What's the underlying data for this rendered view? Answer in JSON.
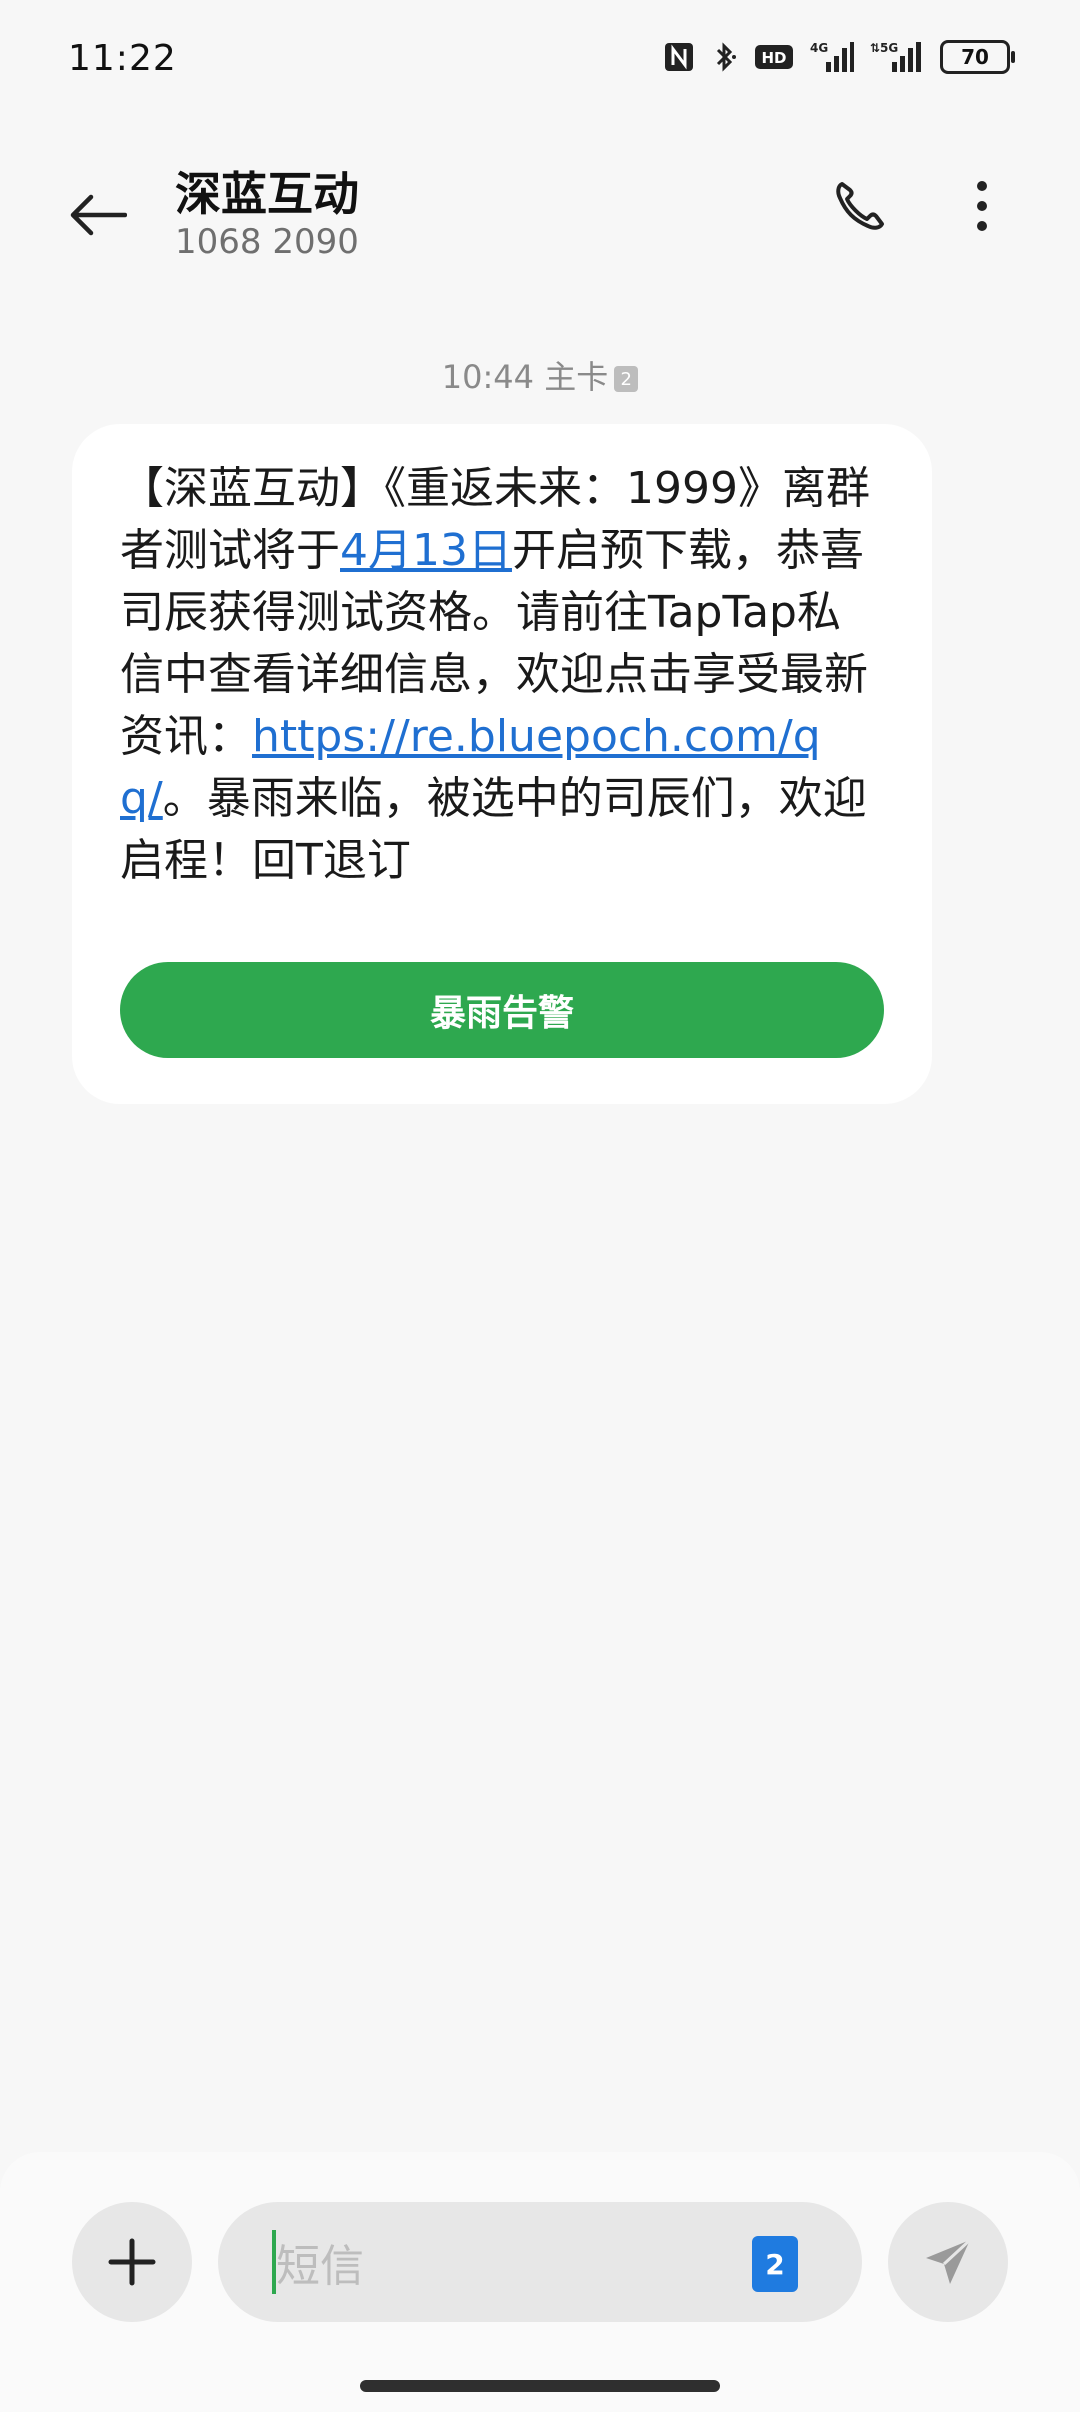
{
  "status_bar": {
    "time": "11:22",
    "battery": "70",
    "icons": [
      "nfc-icon",
      "bluetooth-icon",
      "hd-icon",
      "signal-4g-icon",
      "signal-5g-icon"
    ]
  },
  "header": {
    "contact_name": "深蓝互动",
    "contact_number": "1068 2090"
  },
  "conversation": {
    "timestamp": "10:44 主卡",
    "sim_badge": "2",
    "message": {
      "prefix": "【深蓝互动】《重返未来：1999》离群者测试将于",
      "date_link": "4月13日",
      "middle": "开启预下载，恭喜司辰获得测试资格。请前往TapTap私信中查看详细信息，欢迎点击享受最新资讯：",
      "url_link": "https://re.bluepoch.com/qq/",
      "suffix": "。暴雨来临，被选中的司辰们，欢迎启程！回T退订"
    },
    "action_button": "暴雨告警"
  },
  "composer": {
    "placeholder": "短信",
    "sim_indicator": "2"
  },
  "colors": {
    "accent_green": "#2ea84f",
    "link_blue": "#1f6fd1",
    "background": "#f7f7f7"
  }
}
